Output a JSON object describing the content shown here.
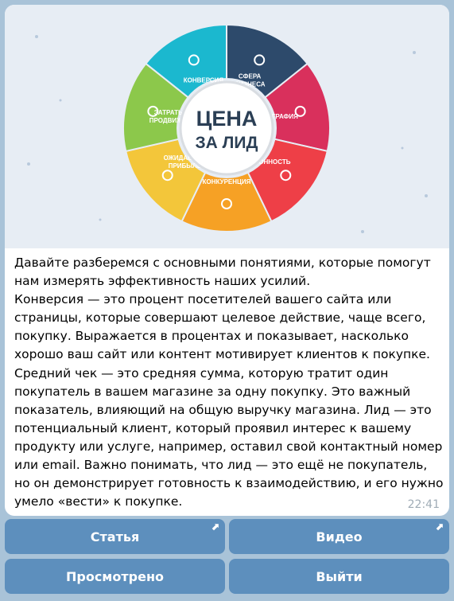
{
  "message": {
    "image": {
      "center_title_line1": "ЦЕНА",
      "center_title_line2": "ЗА ЛИД",
      "segments": [
        {
          "label": "КОНВЕРСИЯ",
          "color": "#1bb8cf",
          "icon": "chart-icon"
        },
        {
          "label": "СФЕРА БИЗНЕСА",
          "color": "#2d4a6b",
          "icon": "bank-icon"
        },
        {
          "label": "ГЕОГРАФИЯ",
          "color": "#d9305c",
          "icon": "globe-icon"
        },
        {
          "label": "СЕЗОННОСТЬ",
          "color": "#ee3f47",
          "icon": "beach-icon"
        },
        {
          "label": "КОНКУРЕНЦИЯ",
          "color": "#f6a125",
          "icon": "target-icon"
        },
        {
          "label": "ОЖИДАЕМАЯ ПРИБЫЛЬ",
          "color": "#f3c63a",
          "icon": "money-bag-icon"
        },
        {
          "label": "ЗАТРАТЫ НА ПРОДВИЖЕНИЕ",
          "color": "#8cc84b",
          "icon": "cycle-icon"
        }
      ]
    },
    "text": "Давайте разберемся с основными понятиями, которые помогут нам измерять эффективность наших усилий.\nКонверсия — это процент посетителей вашего сайта или страницы, которые совершают целевое действие, чаще всего, покупку. Выражается в процентах и показывает, насколько хорошо ваш сайт или контент мотивирует клиентов к покупке. Средний чек — это средняя сумма, которую тратит один покупатель в вашем магазине за одну покупку. Это важный показатель, влияющий на общую выручку магазина. Лид — это потенциальный клиент, который проявил интерес к вашему продукту или услуге, например, оставил свой контактный номер или email. Важно понимать, что лид — это ещё не покупатель, но он демонстрирует готовность к взаимодействию, и его нужно умело «вести» к покупке.",
    "time": "22:41"
  },
  "buttons": {
    "article": "Статья",
    "video": "Видео",
    "viewed": "Просмотрено",
    "exit": "Выйти",
    "link_arrow": "⬈"
  },
  "colors": {
    "chat_background": "#a9c3d8",
    "button": "#5d8fbd",
    "card_background": "#ffffff"
  }
}
